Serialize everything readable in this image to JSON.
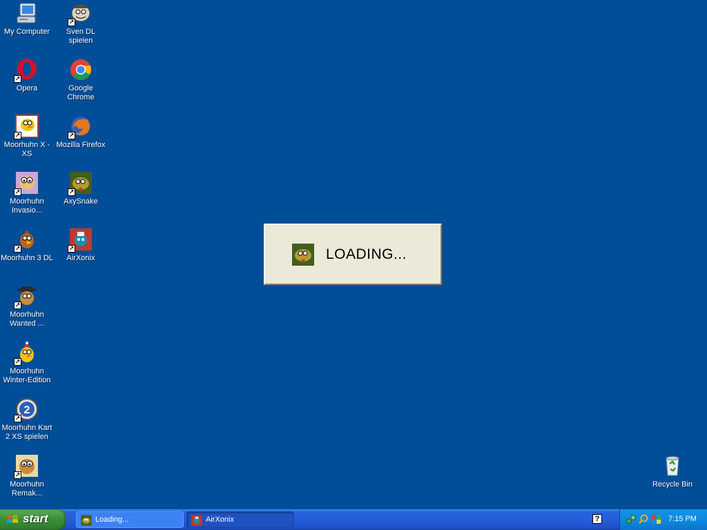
{
  "desktop": {
    "icons_left": [
      {
        "label": "My Computer",
        "icon": "my-computer-icon"
      },
      {
        "label": "Opera",
        "icon": "opera-icon"
      },
      {
        "label": "Moorhuhn X - XS",
        "icon": "moorhuhn-icon"
      },
      {
        "label": "Moorhuhn Invasio...",
        "icon": "moorhuhn-invasion-icon"
      },
      {
        "label": "Moorhuhn 3 DL",
        "icon": "moorhuhn-3-icon"
      },
      {
        "label": "Moorhuhn Wanted ...",
        "icon": "moorhuhn-wanted-icon"
      },
      {
        "label": "Moorhuhn Winter-Edition",
        "icon": "moorhuhn-winter-icon"
      },
      {
        "label": "Moorhuhn Kart 2 XS spielen",
        "icon": "moorhuhn-kart-icon"
      },
      {
        "label": "Moorhuhn Remak...",
        "icon": "moorhuhn-remake-icon"
      }
    ],
    "icons_right": [
      {
        "label": "Sven DL spielen",
        "icon": "sven-icon"
      },
      {
        "label": "Google Chrome",
        "icon": "chrome-icon"
      },
      {
        "label": "Mozilla Firefox",
        "icon": "firefox-icon"
      },
      {
        "label": "AxySnake",
        "icon": "axysnake-icon"
      },
      {
        "label": "AirXonix",
        "icon": "airxonix-icon"
      }
    ],
    "recycle_bin": {
      "label": "Recycle Bin",
      "icon": "recycle-bin-icon"
    },
    "background_color": "#004e98"
  },
  "dialog": {
    "text": "LOADING...",
    "icon": "axysnake-icon"
  },
  "taskbar": {
    "start_label": "start",
    "buttons": [
      {
        "label": "Loading...",
        "icon": "axysnake-icon"
      },
      {
        "label": "AirXonix",
        "icon": "airxonix-icon"
      }
    ],
    "help_glyph": "?",
    "clock": "7:15 PM"
  }
}
